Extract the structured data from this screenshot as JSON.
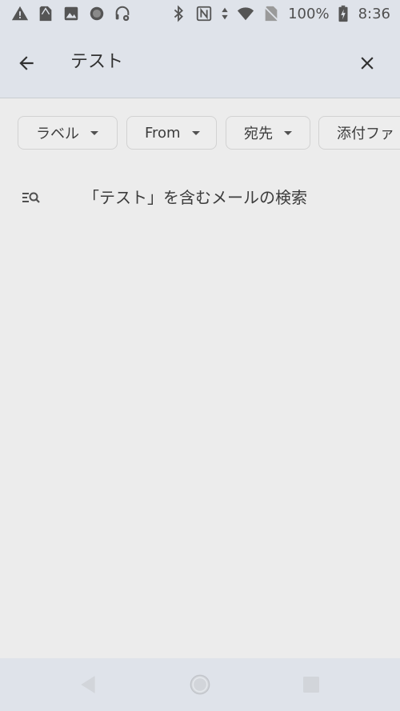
{
  "status_bar": {
    "battery_percent": "100%",
    "time": "8:36",
    "icons_left": [
      "warning-icon",
      "sim-card-icon",
      "image-icon",
      "circle-icon",
      "headset-settings-icon"
    ],
    "icons_right": [
      "bluetooth-icon",
      "nfc-icon",
      "data-arrows-icon",
      "wifi-icon",
      "no-sim-icon",
      "battery-charging-icon"
    ]
  },
  "search": {
    "query": "テスト",
    "back_icon": "arrow-back-icon",
    "clear_icon": "close-icon"
  },
  "filters": {
    "chips": [
      {
        "label": "ラベル"
      },
      {
        "label": "From"
      },
      {
        "label": "宛先"
      },
      {
        "label": "添付ファ"
      }
    ]
  },
  "suggestions": [
    {
      "text": "「テスト」を含むメールの検索",
      "icon": "search-list-icon"
    }
  ],
  "colors": {
    "header_bg": "#dfe3ea",
    "body_bg": "#ececec",
    "text": "#3c3c3c"
  }
}
